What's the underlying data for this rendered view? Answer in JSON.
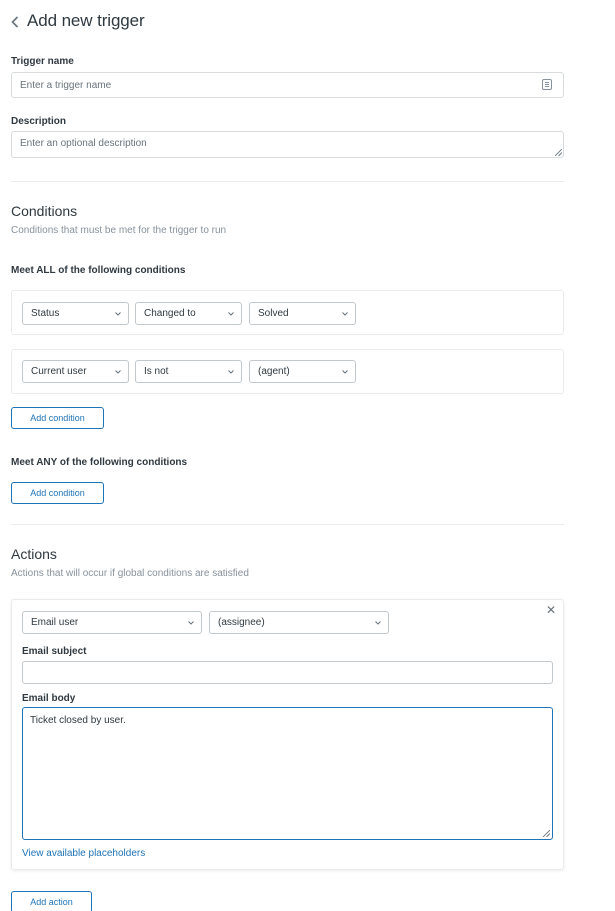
{
  "page": {
    "title": "Add new trigger"
  },
  "trigger_name": {
    "label": "Trigger name",
    "placeholder": "Enter a trigger name"
  },
  "description": {
    "label": "Description",
    "placeholder": "Enter an optional description"
  },
  "conditions": {
    "title": "Conditions",
    "subtitle": "Conditions that must be met for the trigger to run",
    "all": {
      "label": "Meet ALL of the following conditions",
      "rows": [
        {
          "field": "Status",
          "operator": "Changed to",
          "value": "Solved"
        },
        {
          "field": "Current user",
          "operator": "Is not",
          "value": "(agent)"
        }
      ],
      "add_label": "Add condition"
    },
    "any": {
      "label": "Meet ANY of the following conditions",
      "add_label": "Add condition"
    }
  },
  "actions": {
    "title": "Actions",
    "subtitle": "Actions that will occur if global conditions are satisfied",
    "items": [
      {
        "type": "Email user",
        "target": "(assignee)",
        "subject_label": "Email subject",
        "subject_value": "",
        "body_label": "Email body",
        "body_value": "Ticket closed by user.",
        "placeholders_link": "View available placeholders"
      }
    ],
    "add_label": "Add action"
  },
  "colors": {
    "accent": "#1f73b7",
    "text": "#2f3941",
    "muted": "#87929d",
    "border": "#d8dcde"
  },
  "icons": {
    "back": "chevron-left-icon",
    "close": "close-icon",
    "dropdown": "chevron-down-icon",
    "keyboard": "keyboard-icon"
  }
}
